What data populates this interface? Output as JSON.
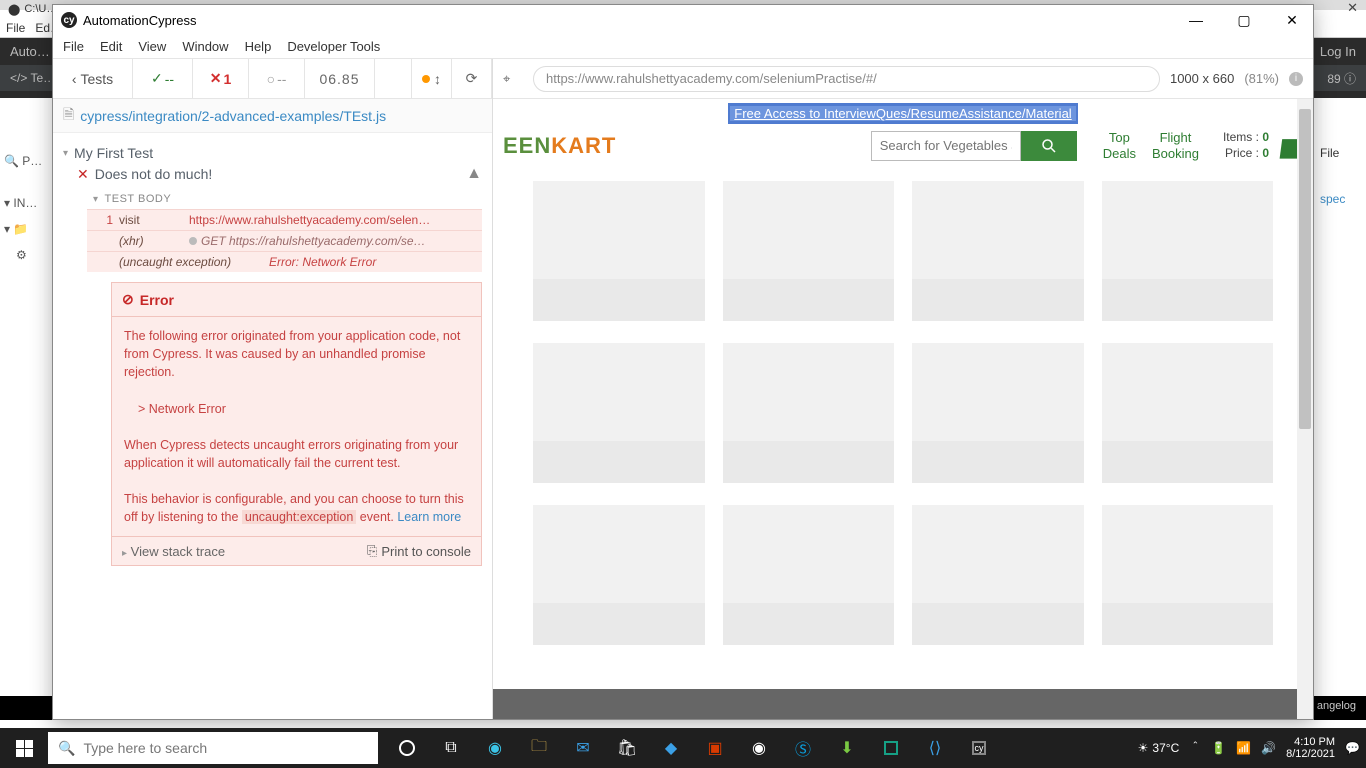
{
  "back": {
    "tab_title": "C:\\U…",
    "menus": [
      "File",
      "Ed…"
    ],
    "dark_left": "Auto…",
    "dark_right": "Log In",
    "row2_left": "</>  Te…",
    "row2_right": "89 ⓘ",
    "side": {
      "search": "🔍 P…",
      "in": "▾ IN…",
      "folder": "▾ 📁",
      "gear": "⚙"
    },
    "right": [
      "File",
      "spec"
    ],
    "bottom_right": "angelog"
  },
  "cypress": {
    "title": "AutomationCypress",
    "menus": [
      "File",
      "Edit",
      "View",
      "Window",
      "Help",
      "Developer Tools"
    ],
    "controls": {
      "min": "—",
      "max": "▢",
      "close": "✕"
    }
  },
  "reporter": {
    "tests_label": "Tests",
    "pass": "--",
    "fail": "1",
    "pending": "--",
    "time": "06.85",
    "spec_path": "cypress/integration/2-advanced-examples/TEst.js",
    "suite": "My First Test",
    "test": "Does not do much!",
    "body_label": "TEST BODY",
    "cmds": [
      {
        "num": "1",
        "name": "visit",
        "msg": "https://www.rahulshettyacademy.com/selen…"
      },
      {
        "num": "",
        "name": "(xhr)",
        "msg": "GET https://rahulshettyacademy.com/se…",
        "icon": true
      },
      {
        "num": "",
        "name": "(uncaught exception)",
        "msg": "Error: Network Error",
        "em2": true
      }
    ],
    "error": {
      "title": "Error",
      "p1": "The following error originated from your application code, not from Cypress. It was caused by an unhandled promise rejection.",
      "p2": "> Network Error",
      "p3": "When Cypress detects uncaught errors originating from your application it will automatically fail the current test.",
      "p4a": "This behavior is configurable, and you can choose to turn this off by listening to the ",
      "p4code": "uncaught:exception",
      "p4b": " event. ",
      "learn": "Learn more",
      "stack": "View stack trace",
      "print": "Print to console"
    }
  },
  "aut": {
    "url": "https://www.rahulshettyacademy.com/seleniumPractise/#/",
    "dims": "1000 x 660",
    "pct": "(81%)"
  },
  "greenkart": {
    "banner": "Free Access to InterviewQues/ResumeAssistance/Material",
    "logo_a": "EEN",
    "logo_b": "KART",
    "search_placeholder": "Search for Vegetables a",
    "links": {
      "deals1": "Top",
      "deals2": "Deals",
      "flight1": "Flight",
      "flight2": "Booking"
    },
    "cart": {
      "items_label": "Items",
      "items_val": "0",
      "price_label": "Price",
      "price_val": "0"
    }
  },
  "taskbar": {
    "search_placeholder": "Type here to search",
    "weather": "37°C",
    "time": "4:10 PM",
    "date": "8/12/2021"
  }
}
